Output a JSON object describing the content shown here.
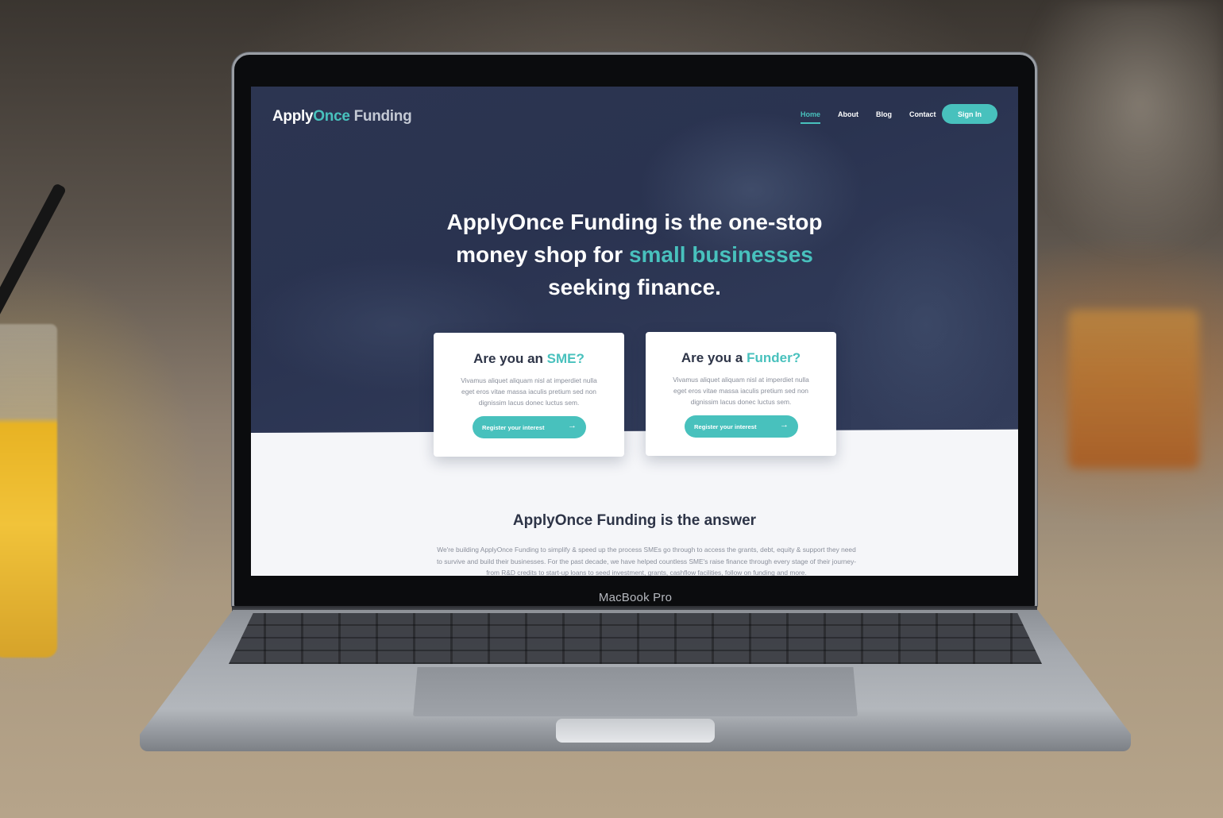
{
  "device": {
    "brand_label": "MacBook Pro"
  },
  "site": {
    "logo": {
      "part1": "Apply",
      "part2": "Once",
      "part3": " Funding"
    },
    "nav": [
      {
        "label": "Home",
        "active": true
      },
      {
        "label": "About",
        "active": false
      },
      {
        "label": "Blog",
        "active": false
      },
      {
        "label": "Contact",
        "active": false
      }
    ],
    "signin_label": "Sign In",
    "hero": {
      "line1": "ApplyOnce Funding is the one-stop",
      "line2_pre": "money shop for ",
      "line2_highlight": "small businesses",
      "line3": "seeking finance."
    },
    "cards": [
      {
        "title_pre": "Are you an ",
        "title_highlight": "SME?",
        "body": "Vivamus aliquet aliquam nisl at imperdiet nulla eget eros vitae massa iaculis pretium sed non dignissim lacus donec luctus sem.",
        "button": "Register your interest"
      },
      {
        "title_pre": "Are you a ",
        "title_highlight": "Funder?",
        "body": "Vivamus aliquet aliquam nisl at imperdiet nulla eget eros vitae massa iaculis pretium sed non dignissim lacus donec luctus sem.",
        "button": "Register your interest"
      }
    ],
    "answer": {
      "title": "ApplyOnce Funding is the answer",
      "body": "We're building ApplyOnce Funding to simplify & speed up the process SMEs go through to access the grants, debt, equity & support they need to survive and build their businesses. For the past decade, we have helped countless SME's raise finance through every stage of their journey- from R&D credits to start-up loans to seed investment, grants, cashflow facilities, follow on funding and more."
    },
    "colors": {
      "accent": "#48c1bd",
      "hero_bg": "#2c3551",
      "text_dark": "#2d3447"
    }
  }
}
